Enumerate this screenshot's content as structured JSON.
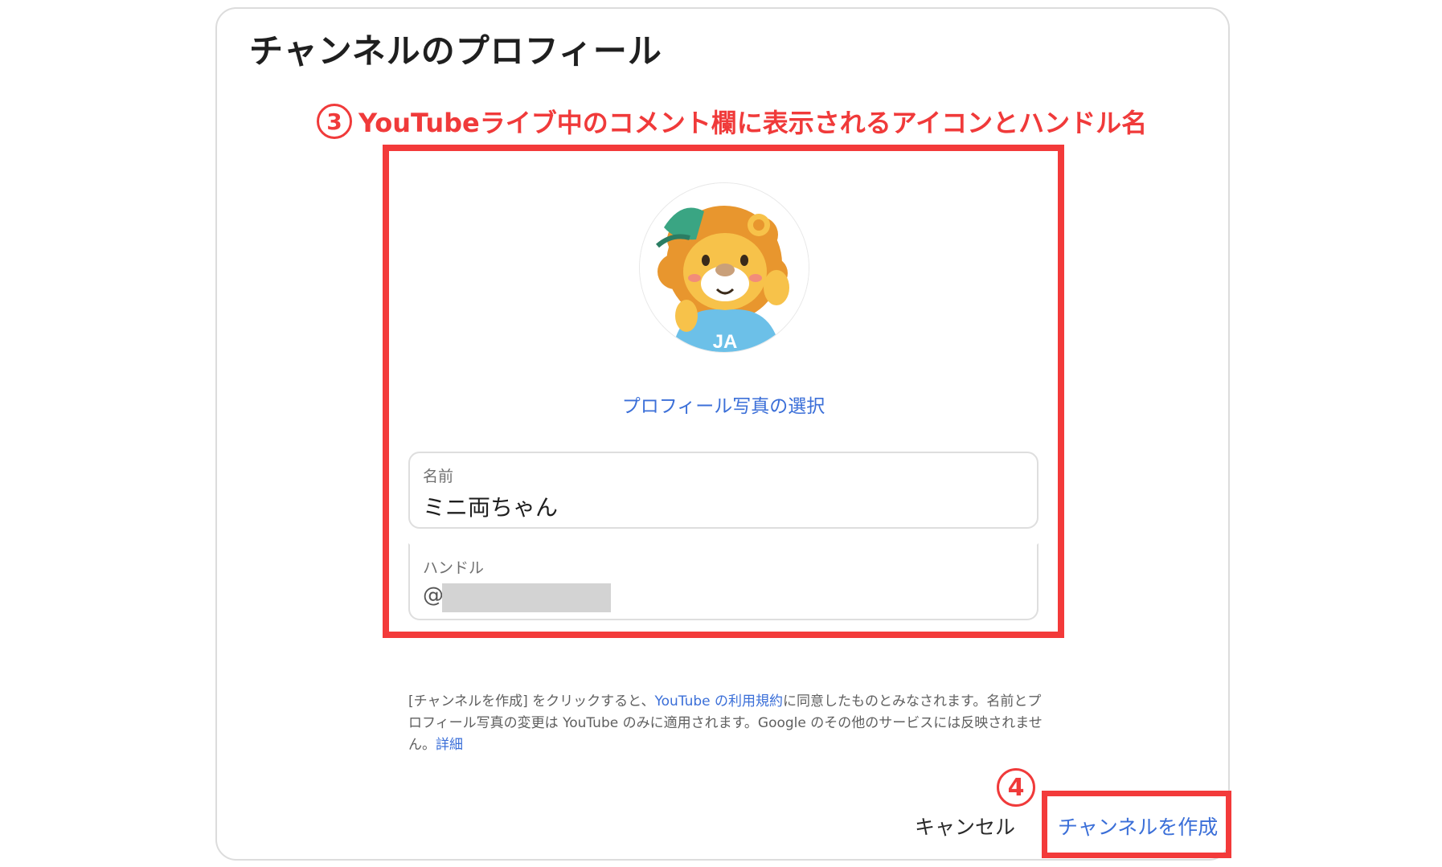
{
  "dialog": {
    "title": "チャンネルのプロフィール",
    "profile_photo_link": "プロフィール写真の選択",
    "name_field": {
      "label": "名前",
      "value": "ミニ両ちゃん"
    },
    "handle_field": {
      "label": "ハンドル",
      "prefix": "@"
    },
    "terms": {
      "part1": "[チャンネルを作成] をクリックすると、",
      "link1": "YouTube の利用規約",
      "part2": "に同意したものとみなされます。名前とプロフィール写真の変更は YouTube のみに適用されます。Google のその他のサービスには反映されません。",
      "link2": "詳細"
    },
    "cancel_label": "キャンセル",
    "create_label": "チャンネルを作成"
  },
  "annotations": {
    "step3": {
      "number": "3",
      "text": "YouTubeライブ中のコメント欄に表示されるアイコンとハンドル名"
    },
    "step4": {
      "number": "4"
    },
    "color": "#f03a3a"
  },
  "colors": {
    "link": "#3b6fd8",
    "accent_red": "#f33a3a"
  },
  "icons": {
    "avatar": "lion-mascot-avatar"
  }
}
